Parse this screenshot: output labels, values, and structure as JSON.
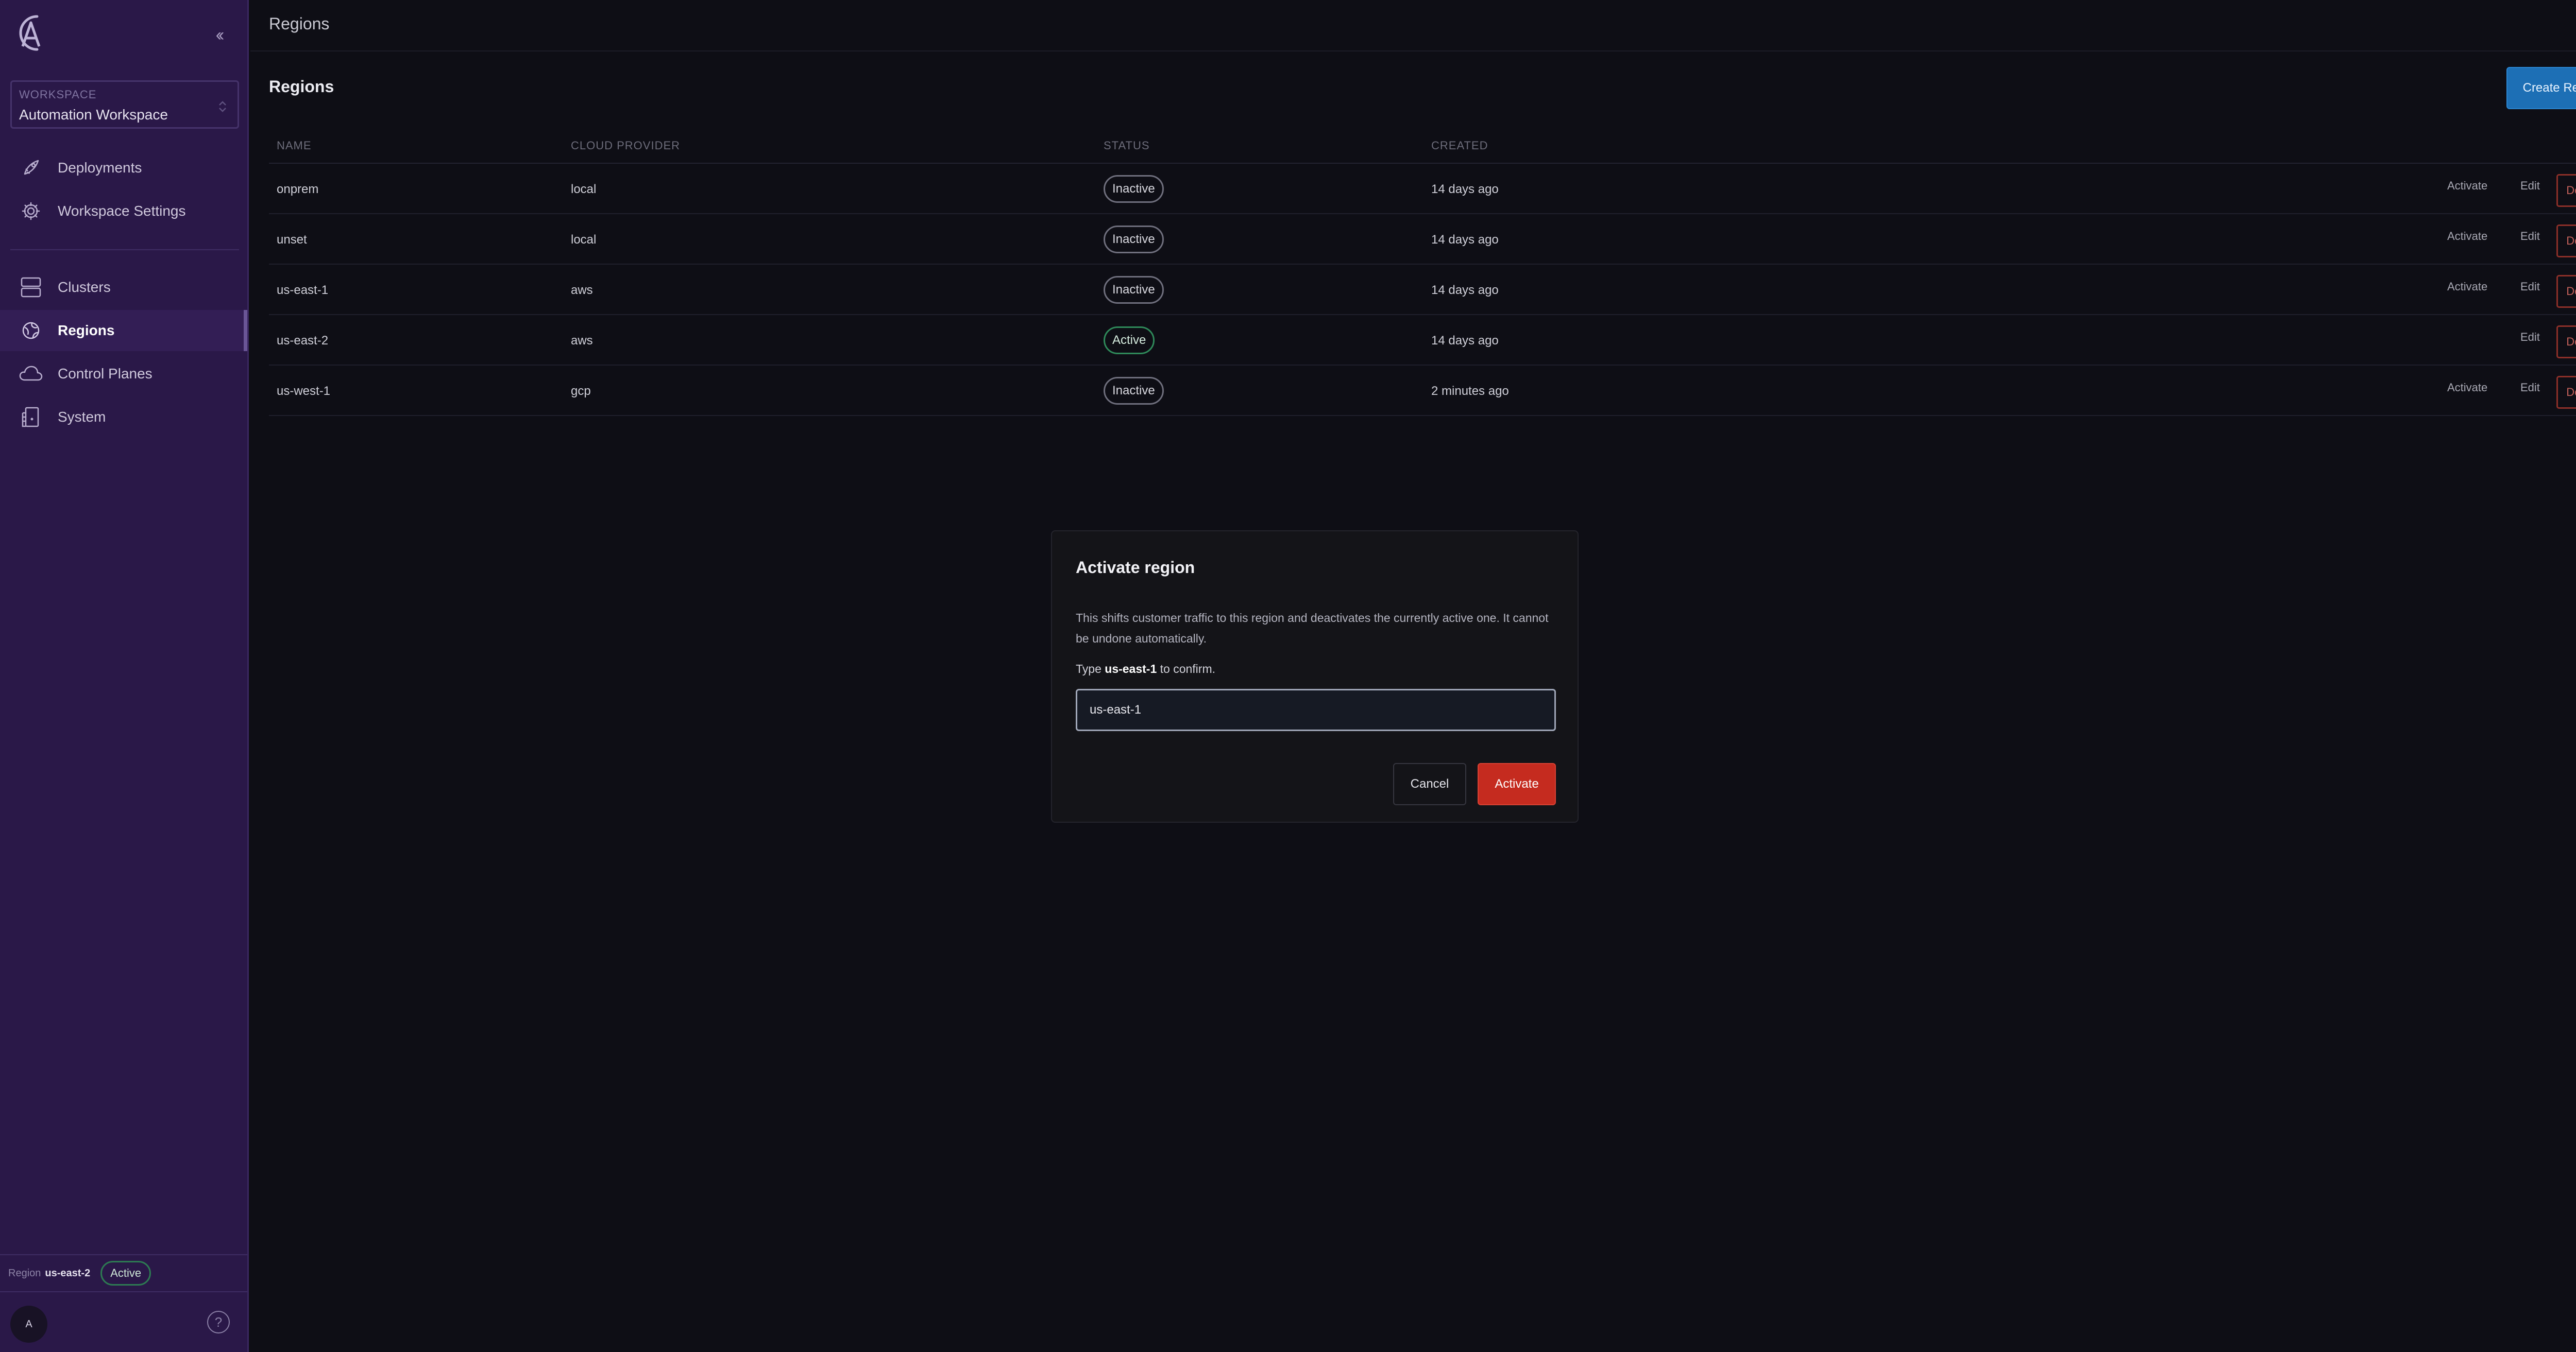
{
  "sidebar": {
    "workspace_label": "WORKSPACE",
    "workspace_name": "Automation Workspace",
    "nav_primary": [
      {
        "label": "Deployments",
        "icon": "rocket-icon"
      },
      {
        "label": "Workspace Settings",
        "icon": "gear-icon"
      }
    ],
    "nav_secondary": [
      {
        "label": "Clusters",
        "icon": "server-icon"
      },
      {
        "label": "Regions",
        "icon": "globe-icon",
        "active": true
      },
      {
        "label": "Control Planes",
        "icon": "cloud-icon"
      },
      {
        "label": "System",
        "icon": "system-icon"
      }
    ],
    "footer": {
      "region_label": "Region",
      "region_name": "us-east-2",
      "status": "Active",
      "avatar": "A",
      "help": "?"
    }
  },
  "topbar": {
    "title": "Regions"
  },
  "page": {
    "title": "Regions",
    "create_label": "Create Region"
  },
  "table": {
    "columns": [
      "NAME",
      "CLOUD PROVIDER",
      "STATUS",
      "CREATED"
    ],
    "rows": [
      {
        "name": "onprem",
        "provider": "local",
        "status": "Inactive",
        "created": "14 days ago",
        "activate": "Activate",
        "edit": "Edit",
        "delete": "Delete"
      },
      {
        "name": "unset",
        "provider": "local",
        "status": "Inactive",
        "created": "14 days ago",
        "activate": "Activate",
        "edit": "Edit",
        "delete": "Delete"
      },
      {
        "name": "us-east-1",
        "provider": "aws",
        "status": "Inactive",
        "created": "14 days ago",
        "activate": "Activate",
        "edit": "Edit",
        "delete": "Delete"
      },
      {
        "name": "us-east-2",
        "provider": "aws",
        "status": "Active",
        "created": "14 days ago",
        "edit": "Edit",
        "delete": "Delete"
      },
      {
        "name": "us-west-1",
        "provider": "gcp",
        "status": "Inactive",
        "created": "2 minutes ago",
        "activate": "Activate",
        "edit": "Edit",
        "delete": "Delete"
      }
    ]
  },
  "modal": {
    "title": "Activate region",
    "description": "This shifts customer traffic to this region and deactivates the currently active one. It cannot be undone automatically.",
    "confirm_prefix": "Type",
    "confirm_target": "us-east-1",
    "confirm_suffix": "to confirm.",
    "input_value": "us-east-1",
    "cancel_label": "Cancel",
    "activate_label": "Activate"
  },
  "colors": {
    "sidebar_bg": "#2a1848",
    "main_bg": "#0e0e15",
    "primary_button": "#1d6fb5",
    "danger": "#c52b1f",
    "active_green": "#2f8a5a"
  }
}
